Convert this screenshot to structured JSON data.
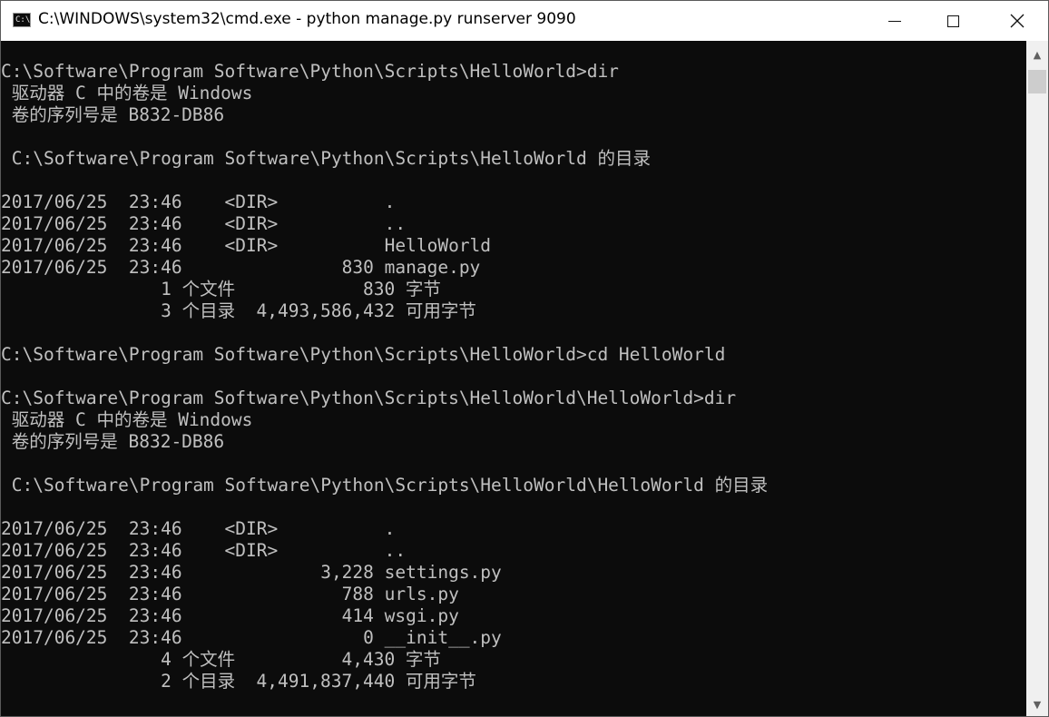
{
  "window": {
    "title": "C:\\WINDOWS\\system32\\cmd.exe - python  manage.py runserver 9090",
    "icon": "cmd-app-icon",
    "icon_text": "C:\\",
    "minimize": "—",
    "maximize": "☐",
    "close": "✕"
  },
  "console": {
    "lines": [
      "",
      "C:\\Software\\Program Software\\Python\\Scripts\\HelloWorld>dir",
      " 驱动器 C 中的卷是 Windows",
      " 卷的序列号是 B832-DB86",
      "",
      " C:\\Software\\Program Software\\Python\\Scripts\\HelloWorld 的目录",
      "",
      "2017/06/25  23:46    <DIR>          .",
      "2017/06/25  23:46    <DIR>          ..",
      "2017/06/25  23:46    <DIR>          HelloWorld",
      "2017/06/25  23:46               830 manage.py",
      "               1 个文件            830 字节",
      "               3 个目录  4,493,586,432 可用字节",
      "",
      "C:\\Software\\Program Software\\Python\\Scripts\\HelloWorld>cd HelloWorld",
      "",
      "C:\\Software\\Program Software\\Python\\Scripts\\HelloWorld\\HelloWorld>dir",
      " 驱动器 C 中的卷是 Windows",
      " 卷的序列号是 B832-DB86",
      "",
      " C:\\Software\\Program Software\\Python\\Scripts\\HelloWorld\\HelloWorld 的目录",
      "",
      "2017/06/25  23:46    <DIR>          .",
      "2017/06/25  23:46    <DIR>          ..",
      "2017/06/25  23:46             3,228 settings.py",
      "2017/06/25  23:46               788 urls.py",
      "2017/06/25  23:46               414 wsgi.py",
      "2017/06/25  23:46                 0 __init__.py",
      "               4 个文件          4,430 字节",
      "               2 个目录  4,491,837,440 可用字节"
    ]
  },
  "scrollbar": {
    "up_arrow": "▲",
    "down_arrow": "▼"
  },
  "colors": {
    "console_bg": "#0c0c0c",
    "console_text": "#c0c0c0",
    "titlebar_bg": "#ffffff"
  }
}
